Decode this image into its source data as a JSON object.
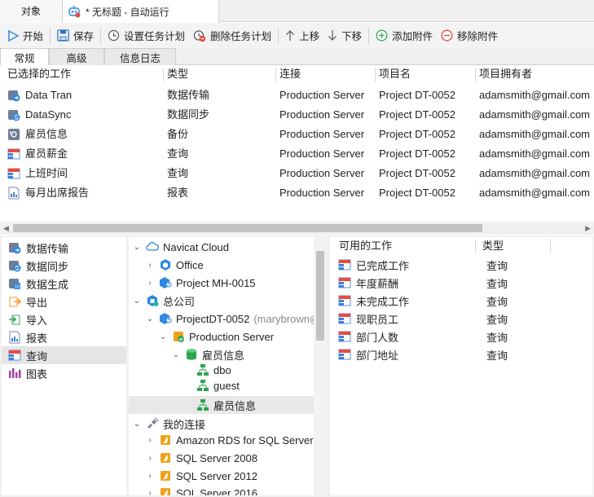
{
  "window_tabs": {
    "objects_label": "对象",
    "active_title": "* 无标题 - 自动运行"
  },
  "toolbar": {
    "start": "开始",
    "save": "保存",
    "set_schedule": "设置任务计划",
    "delete_schedule": "删除任务计划",
    "move_up": "上移",
    "move_down": "下移",
    "add_attachment": "添加附件",
    "remove_attachment": "移除附件"
  },
  "sub_tabs": [
    "常规",
    "高级",
    "信息日志"
  ],
  "selected_jobs": {
    "columns": [
      "已选择的工作",
      "类型",
      "连接",
      "项目名",
      "项目拥有者"
    ],
    "rows": [
      {
        "name": "Data Tran",
        "type": "数据传输",
        "connection": "Production Server",
        "project": "Project DT-0052",
        "owner": "adamsmith@gmail.com",
        "icon": "data-transfer-icon"
      },
      {
        "name": "DataSync",
        "type": "数据同步",
        "connection": "Production Server",
        "project": "Project DT-0052",
        "owner": "adamsmith@gmail.com",
        "icon": "data-sync-icon"
      },
      {
        "name": "雇员信息",
        "type": "备份",
        "connection": "Production Server",
        "project": "Project DT-0052",
        "owner": "adamsmith@gmail.com",
        "icon": "backup-icon"
      },
      {
        "name": "雇员薪金",
        "type": "查询",
        "connection": "Production Server",
        "project": "Project DT-0052",
        "owner": "adamsmith@gmail.com",
        "icon": "query-icon"
      },
      {
        "name": "上班时间",
        "type": "查询",
        "connection": "Production Server",
        "project": "Project DT-0052",
        "owner": "adamsmith@gmail.com",
        "icon": "query-icon"
      },
      {
        "name": "每月出席报告",
        "type": "报表",
        "connection": "Production Server",
        "project": "Project DT-0052",
        "owner": "adamsmith@gmail.com",
        "icon": "report-icon"
      }
    ]
  },
  "job_types": [
    {
      "label": "数据传输",
      "icon": "data-transfer-icon"
    },
    {
      "label": "数据同步",
      "icon": "data-sync-icon"
    },
    {
      "label": "数据生成",
      "icon": "data-generation-icon"
    },
    {
      "label": "导出",
      "icon": "export-icon"
    },
    {
      "label": "导入",
      "icon": "import-icon"
    },
    {
      "label": "报表",
      "icon": "report-icon"
    },
    {
      "label": "查询",
      "icon": "query-icon",
      "selected": true
    },
    {
      "label": "图表",
      "icon": "chart-icon"
    }
  ],
  "tree": {
    "navicat_cloud": "Navicat Cloud",
    "office": "Office",
    "project_mh": "Project MH-0015",
    "company": "总公司",
    "project_dt": "ProjectDT-0052",
    "project_dt_owner": "(marybrown@",
    "production_server": "Production Server",
    "db_employee": "雇员信息",
    "schema_dbo": "dbo",
    "schema_guest": "guest",
    "schema_employee": "雇员信息",
    "my_connections": "我的连接",
    "conn_rds": "Amazon RDS for SQL Server",
    "conn_2008": "SQL Server 2008",
    "conn_2012": "SQL Server 2012",
    "conn_2016": "SQL Server 2016"
  },
  "available_jobs": {
    "columns": [
      "可用的工作",
      "类型"
    ],
    "rows": [
      {
        "name": "已完成工作",
        "type": "查询"
      },
      {
        "name": "年度薪酬",
        "type": "查询"
      },
      {
        "name": "未完成工作",
        "type": "查询"
      },
      {
        "name": "现职员工",
        "type": "查询"
      },
      {
        "name": "部门人数",
        "type": "查询"
      },
      {
        "name": "部门地址",
        "type": "查询"
      }
    ]
  }
}
